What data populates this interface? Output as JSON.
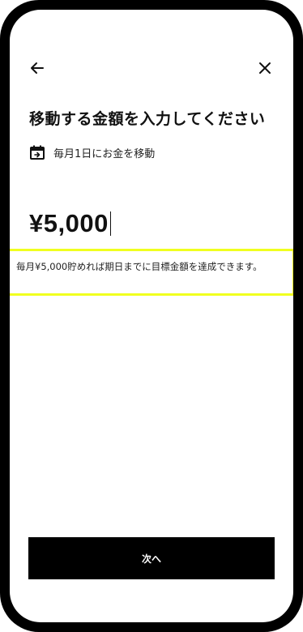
{
  "header": {
    "back_icon": "arrow-left-icon",
    "close_icon": "close-icon"
  },
  "title": "移動する金額を入力してください",
  "schedule": {
    "icon": "calendar-icon",
    "text": "毎月1日にお金を移動"
  },
  "amount": {
    "value": "¥5,000"
  },
  "hint": {
    "text": "毎月¥5,000貯めれば期日までに目標金額を達成できます。",
    "highlight_color": "#f0ff1f"
  },
  "footer": {
    "next_label": "次へ"
  },
  "colors": {
    "frame": "#000000",
    "button_bg": "#000000",
    "button_text": "#ffffff"
  }
}
